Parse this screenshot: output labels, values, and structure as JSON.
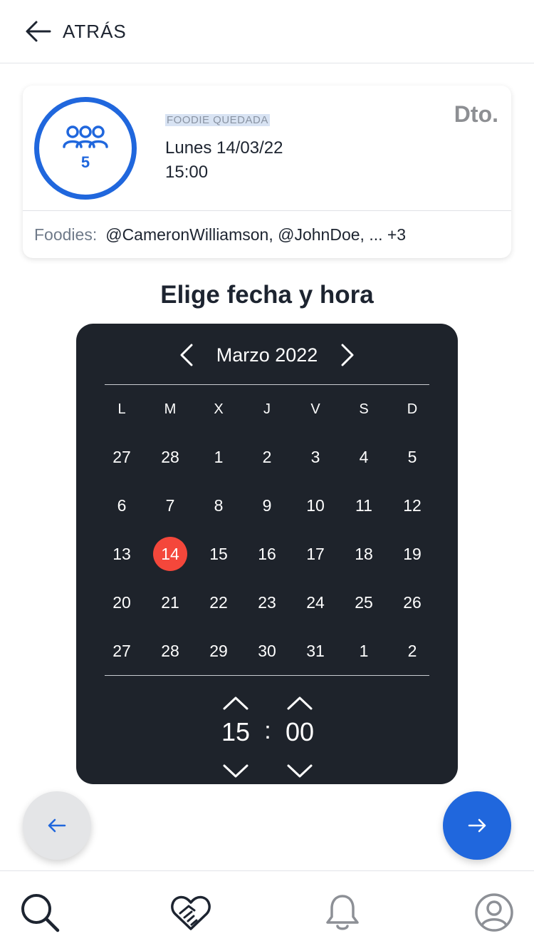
{
  "header": {
    "back_label": "ATRÁS"
  },
  "event_card": {
    "participants_count": "5",
    "type_label": "FOODIE QUEDADA",
    "date": "Lunes 14/03/22",
    "time": "15:00",
    "discount_label": "Dto.",
    "foodies_label": "Foodies:",
    "foodies_value": "@CameronWilliamson, @JohnDoe, ... +3"
  },
  "section_title": "Elige fecha y hora",
  "calendar": {
    "month_label": "Marzo 2022",
    "weekdays": [
      "L",
      "M",
      "X",
      "J",
      "V",
      "S",
      "D"
    ],
    "weeks": [
      [
        "27",
        "28",
        "1",
        "2",
        "3",
        "4",
        "5"
      ],
      [
        "6",
        "7",
        "8",
        "9",
        "10",
        "11",
        "12"
      ],
      [
        "13",
        "14",
        "15",
        "16",
        "17",
        "18",
        "19"
      ],
      [
        "20",
        "21",
        "22",
        "23",
        "24",
        "25",
        "26"
      ],
      [
        "27",
        "28",
        "29",
        "30",
        "31",
        "1",
        "2"
      ]
    ],
    "selected_day": "14",
    "hour": "15",
    "separator": ":",
    "minute": "00"
  },
  "colors": {
    "accent": "#2067dd",
    "selected": "#f4473b",
    "calendar_bg": "#1e232b"
  },
  "tabbar": {
    "items": [
      "search-icon",
      "handshake-heart-icon",
      "bell-icon",
      "profile-icon"
    ]
  }
}
